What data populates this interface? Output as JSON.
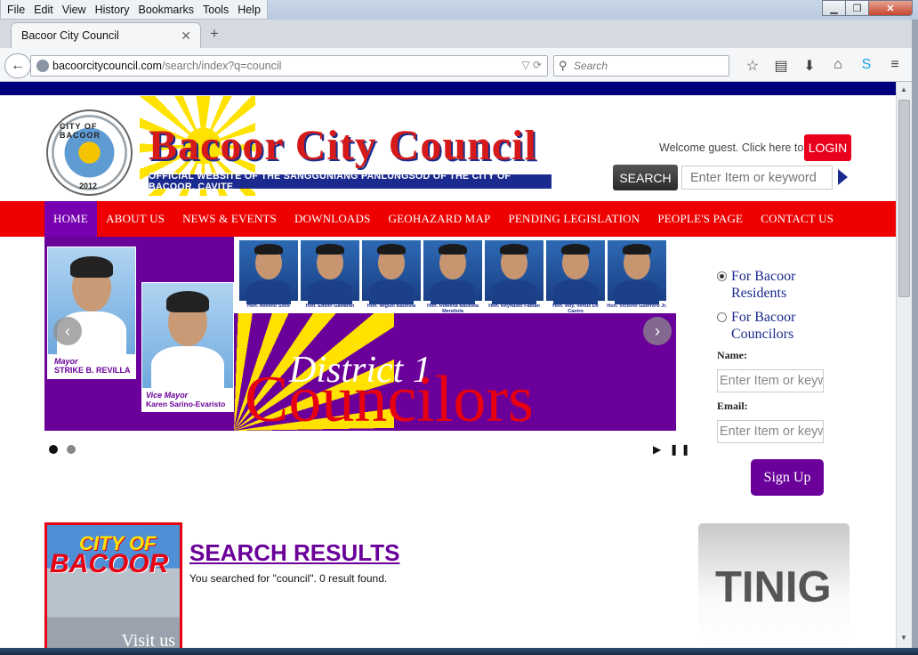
{
  "browser": {
    "menu": [
      "File",
      "Edit",
      "View",
      "History",
      "Bookmarks",
      "Tools",
      "Help"
    ],
    "tab_title": "Bacoor City Council",
    "url_host": "bacoorcitycouncil.com",
    "url_path": "/search/index?q=council",
    "search_placeholder": "Search"
  },
  "header": {
    "seal_text": "CITY OF BACOOR",
    "seal_year": "2012",
    "site_title": "Bacoor City Council",
    "site_subtitle": "OFFICIAL WEBSITE OF THE SANGGUNIANG PANLUNGSOD OF THE CITY OF BACOOR, CAVITE",
    "welcome": "Welcome guest. Click here to",
    "login_label": "LOGIN",
    "search_button": "SEARCH",
    "search_placeholder": "Enter Item or keyword"
  },
  "nav": {
    "items": [
      "HOME",
      "ABOUT US",
      "NEWS & EVENTS",
      "DOWNLOADS",
      "GEOHAZARD MAP",
      "PENDING LEGISLATION",
      "PEOPLE'S PAGE",
      "CONTACT US"
    ],
    "active_index": 0
  },
  "slider": {
    "mayor_role": "Mayor",
    "mayor_name": "STRIKE B. REVILLA",
    "vice_role": "Vice Mayor",
    "vice_name": "Karen Sarino-Evaristo",
    "councilors": [
      "Hon. Avelino Solis",
      "Hon. Edwin Gawaran",
      "Hon. Miguel Bautista",
      "Hon. Rowena Bautista Mendiola",
      "Hon. Reynaldo Fabian",
      "Hon. Atty. Venus De Castro",
      "Hon. Victorio Guerrero Jr."
    ],
    "headline_small": "District 1",
    "headline_big": "Councilors",
    "prev_icon": "‹",
    "next_icon": "›",
    "slide_count": 2,
    "active_slide": 1,
    "play_pause": "▶ ❚❚"
  },
  "signup": {
    "option_residents": "For Bacoor Residents",
    "option_councilors": "For Bacoor Councilors",
    "selected": "residents",
    "name_label": "Name:",
    "email_label": "Email:",
    "field_placeholder": "Enter Item or keyw",
    "button": "Sign Up"
  },
  "content": {
    "visit_city": "CITY OF",
    "visit_bacoor": "BACOOR",
    "visit_us": "Visit us",
    "results_title": "SEARCH RESULTS",
    "results_message": "You searched for \"council\". 0 result found.",
    "tinig": "TINIG"
  },
  "colors": {
    "nav_red": "#ee0000",
    "brand_purple": "#6a0099",
    "top_navy": "#00007c",
    "login_red": "#e8001c"
  }
}
